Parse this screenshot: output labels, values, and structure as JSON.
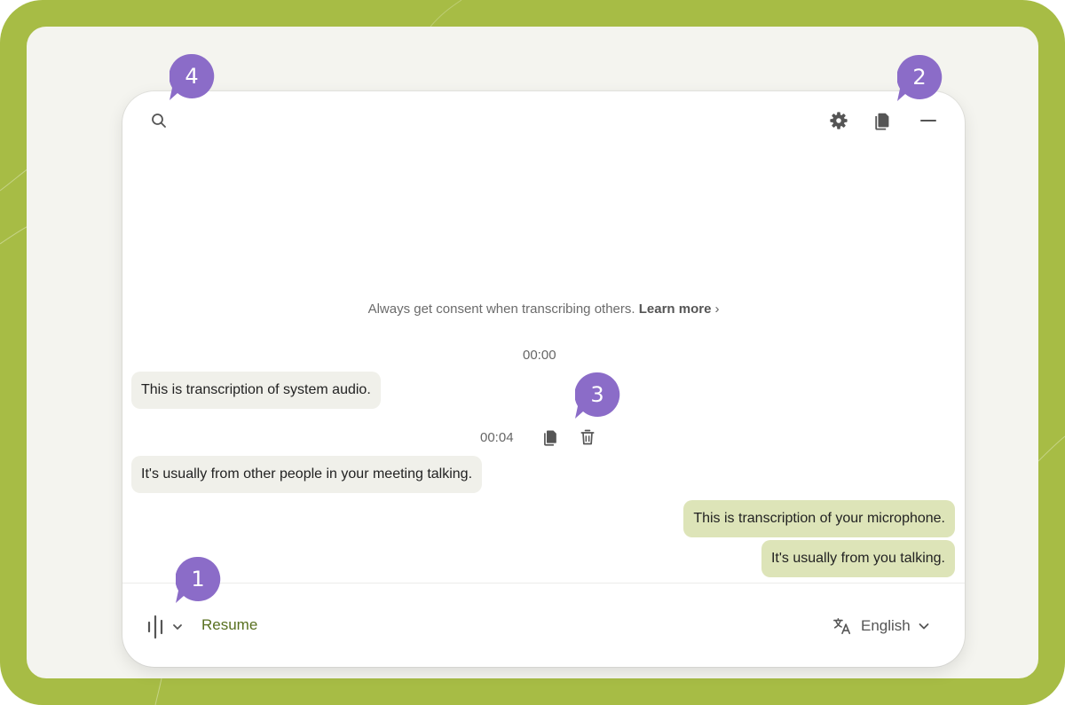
{
  "colors": {
    "backdrop": "#a7bc45",
    "canvas": "#f4f4ef",
    "window": "#ffffff",
    "system_bubble": "#f0f0ea",
    "mic_bubble": "#dde4b8",
    "resume_text": "#58701f",
    "callout": "#8b6cc8"
  },
  "toolbar": {
    "search_icon": "search-icon",
    "settings_icon": "gear-icon",
    "copy_icon": "copy-icon",
    "minimize_icon": "minus-icon"
  },
  "consent": {
    "text": "Always get consent when transcribing others.",
    "link": "Learn more",
    "chevron": "›"
  },
  "transcript": {
    "messages": [
      {
        "timestamp": "00:00",
        "text": "This is transcription of system audio.",
        "source": "system"
      },
      {
        "timestamp": "00:04",
        "text": "It's usually from other people in your meeting talking.",
        "source": "system"
      },
      {
        "text": "This is transcription of your microphone.",
        "source": "microphone"
      },
      {
        "text": "It's usually from you talking.",
        "source": "microphone"
      }
    ],
    "row_actions": {
      "copy_icon": "copy-icon",
      "delete_icon": "trash-icon"
    }
  },
  "footer": {
    "audio_icon": "waveform-icon",
    "resume_label": "Resume",
    "language_icon": "translate-icon",
    "language": "English"
  },
  "callouts": [
    "1",
    "2",
    "3",
    "4"
  ]
}
